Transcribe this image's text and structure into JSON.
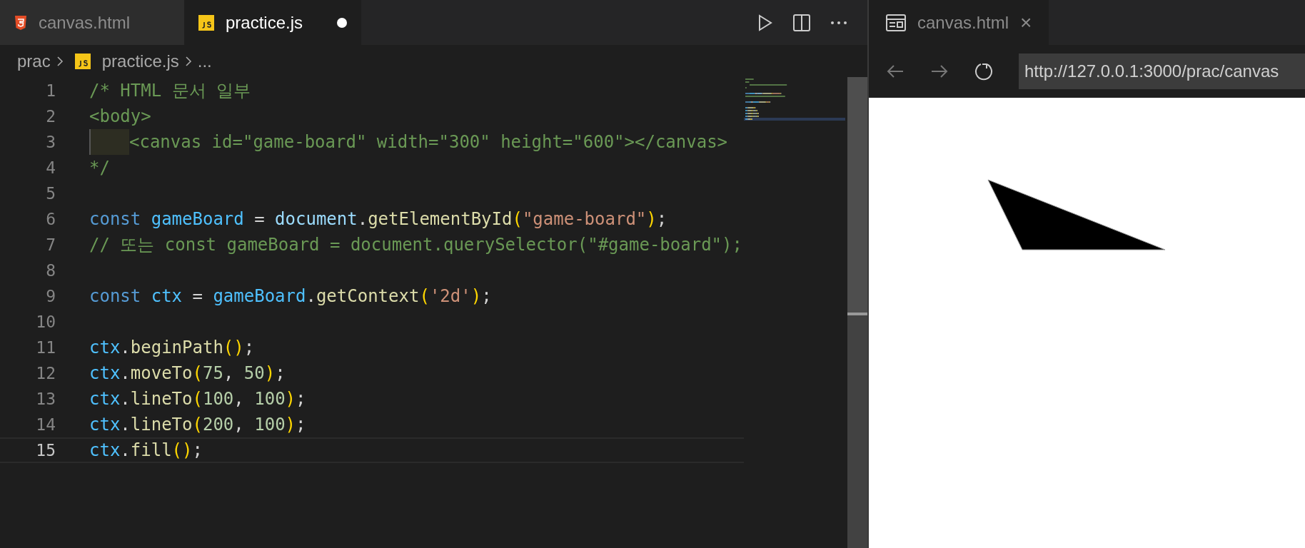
{
  "editor": {
    "tabs": [
      {
        "label": "canvas.html",
        "kind": "html",
        "selected": false,
        "modified": false
      },
      {
        "label": "practice.js",
        "kind": "js",
        "selected": true,
        "modified": true
      }
    ],
    "breadcrumb": {
      "folder": "prac",
      "file": "practice.js",
      "more": "..."
    },
    "lines": [
      {
        "number": "1",
        "current": false,
        "indent_guide": false,
        "tokens": [
          {
            "text": "/* HTML 문서 일부",
            "kind": "comment"
          }
        ]
      },
      {
        "number": "2",
        "current": false,
        "indent_guide": false,
        "tokens": [
          {
            "text": "<body>",
            "kind": "comment"
          }
        ]
      },
      {
        "number": "3",
        "current": false,
        "indent_guide": true,
        "tokens": [
          {
            "text": "<canvas id=\"game-board\" width=\"300\" height=\"600\"></canvas>",
            "kind": "comment"
          }
        ]
      },
      {
        "number": "4",
        "current": false,
        "indent_guide": false,
        "tokens": [
          {
            "text": "*/",
            "kind": "comment"
          }
        ]
      },
      {
        "number": "5",
        "current": false,
        "indent_guide": false
      },
      {
        "number": "6",
        "current": false,
        "indent_guide": false,
        "tokens": [
          {
            "text": "const ",
            "kind": "keyword"
          },
          {
            "text": "gameBoard",
            "kind": "constant"
          },
          {
            "text": " = ",
            "kind": "plain"
          },
          {
            "text": "document",
            "kind": "variable"
          },
          {
            "text": ".",
            "kind": "plain"
          },
          {
            "text": "getElementById",
            "kind": "function"
          },
          {
            "text": "(",
            "kind": "bracket"
          },
          {
            "text": "\"game-board\"",
            "kind": "string"
          },
          {
            "text": ")",
            "kind": "bracket"
          },
          {
            "text": ";",
            "kind": "plain"
          }
        ]
      },
      {
        "number": "7",
        "current": false,
        "indent_guide": false,
        "tokens": [
          {
            "text": "// 또는 const gameBoard = document.querySelector(\"#game-board\");",
            "kind": "comment"
          }
        ]
      },
      {
        "number": "8",
        "current": false,
        "indent_guide": false
      },
      {
        "number": "9",
        "current": false,
        "indent_guide": false,
        "tokens": [
          {
            "text": "const ",
            "kind": "keyword"
          },
          {
            "text": "ctx",
            "kind": "constant"
          },
          {
            "text": " = ",
            "kind": "plain"
          },
          {
            "text": "gameBoard",
            "kind": "constant"
          },
          {
            "text": ".",
            "kind": "plain"
          },
          {
            "text": "getContext",
            "kind": "function"
          },
          {
            "text": "(",
            "kind": "bracket"
          },
          {
            "text": "'2d'",
            "kind": "string"
          },
          {
            "text": ")",
            "kind": "bracket"
          },
          {
            "text": ";",
            "kind": "plain"
          }
        ]
      },
      {
        "number": "10",
        "current": false,
        "indent_guide": false
      },
      {
        "number": "11",
        "current": false,
        "indent_guide": false,
        "tokens": [
          {
            "text": "ctx",
            "kind": "constant"
          },
          {
            "text": ".",
            "kind": "plain"
          },
          {
            "text": "beginPath",
            "kind": "function"
          },
          {
            "text": "()",
            "kind": "bracket"
          },
          {
            "text": ";",
            "kind": "plain"
          }
        ]
      },
      {
        "number": "12",
        "current": false,
        "indent_guide": false,
        "tokens": [
          {
            "text": "ctx",
            "kind": "constant"
          },
          {
            "text": ".",
            "kind": "plain"
          },
          {
            "text": "moveTo",
            "kind": "function"
          },
          {
            "text": "(",
            "kind": "bracket"
          },
          {
            "text": "75",
            "kind": "number"
          },
          {
            "text": ", ",
            "kind": "plain"
          },
          {
            "text": "50",
            "kind": "number"
          },
          {
            "text": ")",
            "kind": "bracket"
          },
          {
            "text": ";",
            "kind": "plain"
          }
        ]
      },
      {
        "number": "13",
        "current": false,
        "indent_guide": false,
        "tokens": [
          {
            "text": "ctx",
            "kind": "constant"
          },
          {
            "text": ".",
            "kind": "plain"
          },
          {
            "text": "lineTo",
            "kind": "function"
          },
          {
            "text": "(",
            "kind": "bracket"
          },
          {
            "text": "100",
            "kind": "number"
          },
          {
            "text": ", ",
            "kind": "plain"
          },
          {
            "text": "100",
            "kind": "number"
          },
          {
            "text": ")",
            "kind": "bracket"
          },
          {
            "text": ";",
            "kind": "plain"
          }
        ]
      },
      {
        "number": "14",
        "current": false,
        "indent_guide": false,
        "tokens": [
          {
            "text": "ctx",
            "kind": "constant"
          },
          {
            "text": ".",
            "kind": "plain"
          },
          {
            "text": "lineTo",
            "kind": "function"
          },
          {
            "text": "(",
            "kind": "bracket"
          },
          {
            "text": "200",
            "kind": "number"
          },
          {
            "text": ", ",
            "kind": "plain"
          },
          {
            "text": "100",
            "kind": "number"
          },
          {
            "text": ")",
            "kind": "bracket"
          },
          {
            "text": ";",
            "kind": "plain"
          }
        ]
      },
      {
        "number": "15",
        "current": true,
        "indent_guide": false,
        "tokens": [
          {
            "text": "ctx",
            "kind": "constant"
          },
          {
            "text": ".",
            "kind": "plain"
          },
          {
            "text": "fill",
            "kind": "function"
          },
          {
            "text": "()",
            "kind": "bracket"
          },
          {
            "text": ";",
            "kind": "plain"
          }
        ]
      }
    ]
  },
  "preview": {
    "tab": {
      "label": "canvas.html",
      "close": "×"
    },
    "url": "http://127.0.0.1:3000/prac/canvas"
  }
}
